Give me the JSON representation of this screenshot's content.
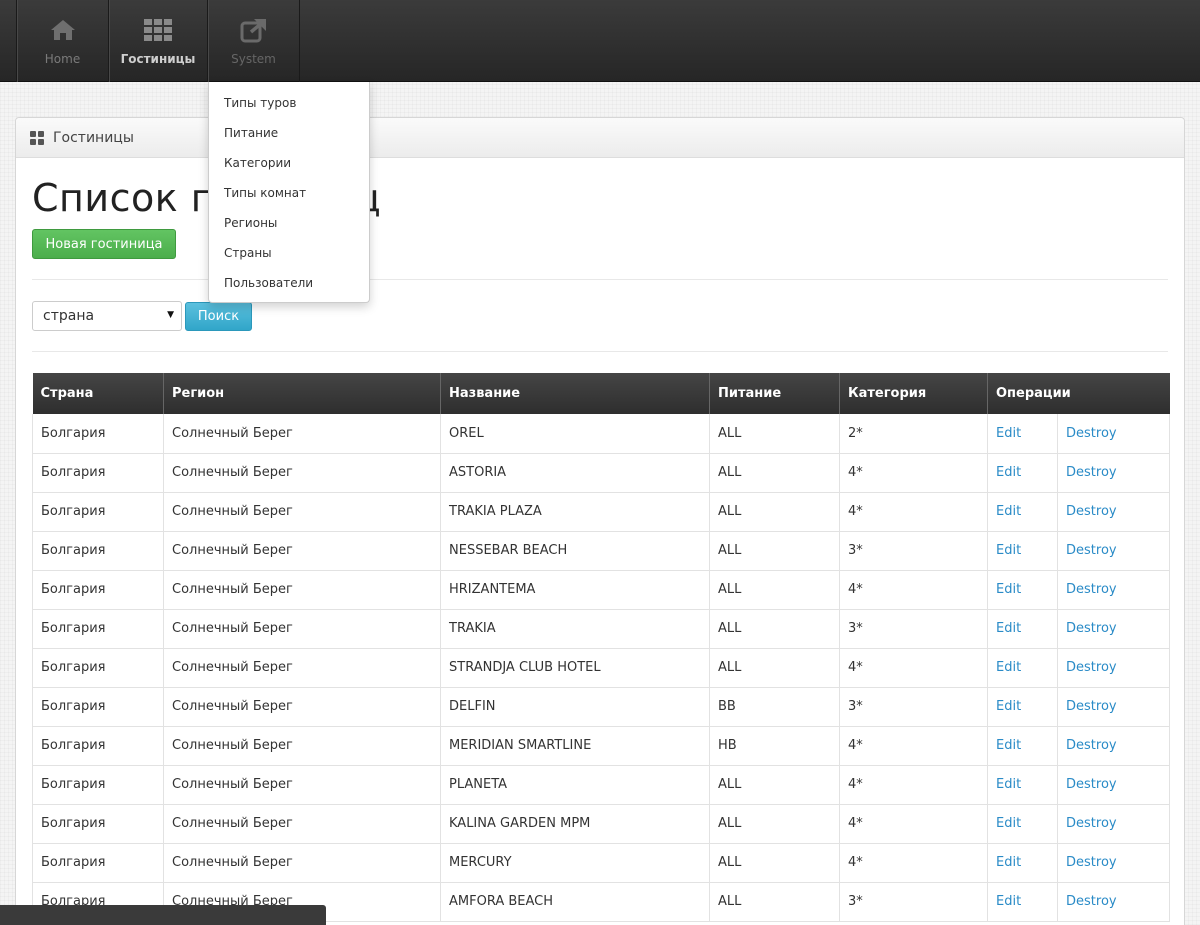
{
  "nav": {
    "items": [
      {
        "label": "Home",
        "icon": "home-icon"
      },
      {
        "label": "Гостиницы",
        "icon": "grid-icon"
      },
      {
        "label": "System",
        "icon": "external-link-icon"
      }
    ]
  },
  "dropdown": {
    "items": [
      "Типы туров",
      "Питание",
      "Категории",
      "Типы комнат",
      "Регионы",
      "Страны",
      "Пользователи"
    ]
  },
  "panel": {
    "title": "Гостиницы"
  },
  "page": {
    "title": "Список гостиниц",
    "new_button": "Новая гостиница",
    "select_value": "страна",
    "search_button": "Поиск"
  },
  "table": {
    "columns": [
      "Страна",
      "Регион",
      "Название",
      "Питание",
      "Категория",
      "Операции"
    ],
    "edit_label": "Edit",
    "destroy_label": "Destroy",
    "rows": [
      {
        "country": "Болгария",
        "region": "Солнечный Берег",
        "name": "OREL",
        "food": "ALL",
        "category": "2*"
      },
      {
        "country": "Болгария",
        "region": "Солнечный Берег",
        "name": "ASTORIA",
        "food": "ALL",
        "category": "4*"
      },
      {
        "country": "Болгария",
        "region": "Солнечный Берег",
        "name": "TRAKIA PLAZA",
        "food": "ALL",
        "category": "4*"
      },
      {
        "country": "Болгария",
        "region": "Солнечный Берег",
        "name": "NESSEBAR BEACH",
        "food": "ALL",
        "category": "3*"
      },
      {
        "country": "Болгария",
        "region": "Солнечный Берег",
        "name": "HRIZANTEMA",
        "food": "ALL",
        "category": "4*"
      },
      {
        "country": "Болгария",
        "region": "Солнечный Берег",
        "name": "TRAKIA",
        "food": "ALL",
        "category": "3*"
      },
      {
        "country": "Болгария",
        "region": "Солнечный Берег",
        "name": "STRANDJA CLUB HOTEL",
        "food": "ALL",
        "category": "4*"
      },
      {
        "country": "Болгария",
        "region": "Солнечный Берег",
        "name": "DELFIN",
        "food": "BB",
        "category": "3*"
      },
      {
        "country": "Болгария",
        "region": "Солнечный Берег",
        "name": "MERIDIAN SMARTLINE",
        "food": "HB",
        "category": "4*"
      },
      {
        "country": "Болгария",
        "region": "Солнечный Берег",
        "name": "PLANETA",
        "food": "ALL",
        "category": "4*"
      },
      {
        "country": "Болгария",
        "region": "Солнечный Берег",
        "name": "KALINA GARDEN MPM",
        "food": "ALL",
        "category": "4*"
      },
      {
        "country": "Болгария",
        "region": "Солнечный Берег",
        "name": "MERCURY",
        "food": "ALL",
        "category": "4*"
      },
      {
        "country": "Болгария",
        "region": "Солнечный Берег",
        "name": "AMFORA BEACH",
        "food": "ALL",
        "category": "3*"
      }
    ]
  },
  "colors": {
    "navbar": "#2e2e2e",
    "success": "#5cb85c",
    "info": "#5bc0de",
    "link": "#2a8bc7"
  }
}
